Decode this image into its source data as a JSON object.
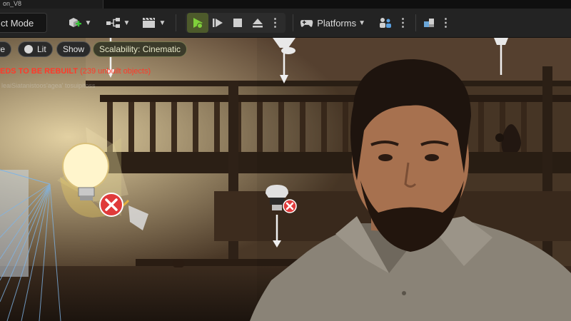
{
  "titlebar": {
    "tab_label": "on_V8"
  },
  "toolbar": {
    "mode_label": "ct Mode",
    "platforms_label": "Platforms",
    "icons": [
      "add-actor-icon",
      "blueprint-icon",
      "cinematics-icon",
      "play-icon",
      "play-next-icon",
      "stop-icon",
      "eject-icon",
      "more-icon",
      "platforms-icon",
      "settings-icon",
      "more-icon",
      "layout-icon",
      "more-icon"
    ]
  },
  "viewport_bar": {
    "view_label": "ve",
    "lit_label": "Lit",
    "show_label": "Show",
    "scalability_label": "Scalability: Cinematic"
  },
  "messages": {
    "rebuild_warning": "EDS TO BE REBUILT",
    "unbuilt_count": "(239 unbuilt objects)",
    "faint_path": "leaiSiatanistoos'agea' tosuipitoss"
  },
  "colors": {
    "warning": "#ff3a2a",
    "play_active": "#4d5a2b",
    "light_error": "#e03b3b"
  }
}
